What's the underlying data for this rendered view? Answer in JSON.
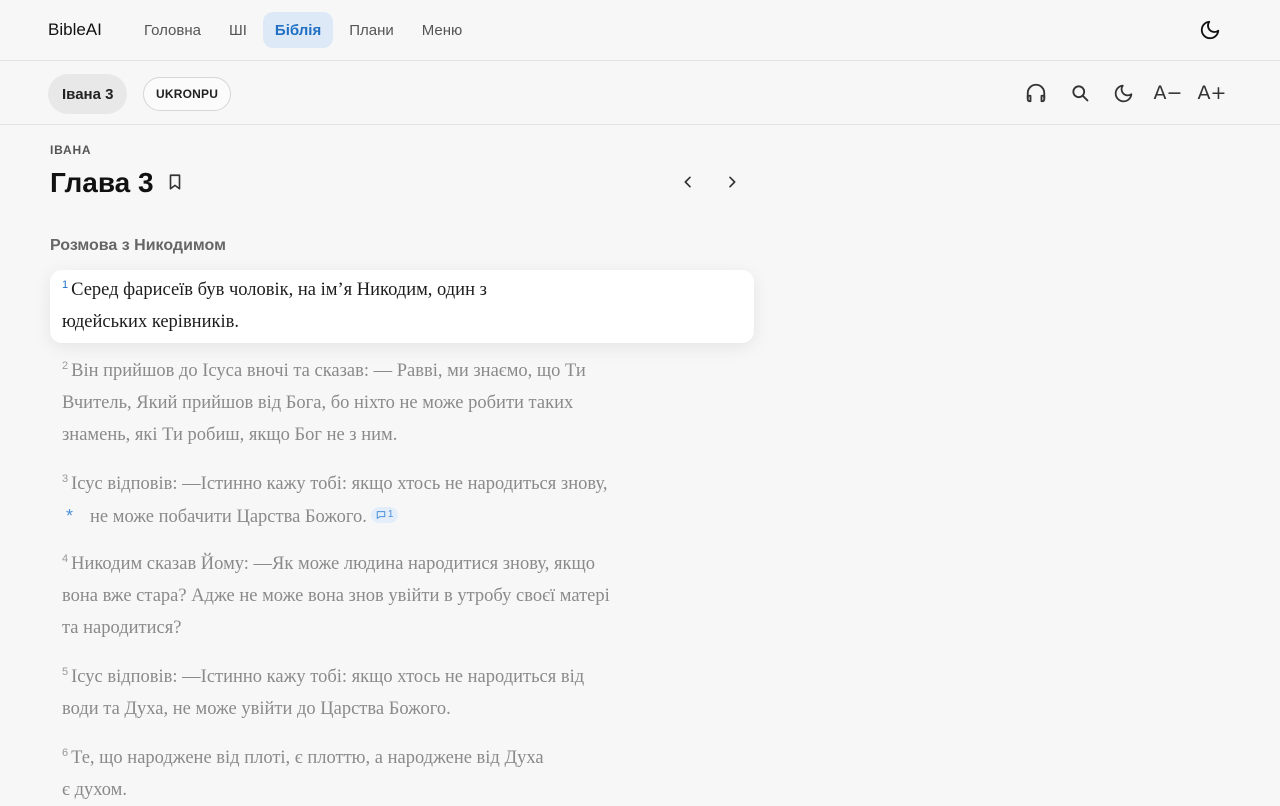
{
  "app": {
    "brand": "BibleAI"
  },
  "nav": {
    "items": [
      {
        "label": "Головна"
      },
      {
        "label": "ШІ"
      },
      {
        "label": "Біблія"
      },
      {
        "label": "Плани"
      },
      {
        "label": "Меню"
      }
    ],
    "active": "Біблія"
  },
  "toolbar": {
    "chapter_chip": "Івана 3",
    "version_chip": "UKRONPU",
    "font_decrease": "A−",
    "font_increase": "A+"
  },
  "reader": {
    "book": "ІВАНА",
    "chapter_title": "Глава 3",
    "section_heading": "Розмова з Никодимом",
    "verses": [
      {
        "num": "1",
        "line1": "Серед фарисеїв був чоловік, на ім’я Никодим, один з",
        "line2": "юдейських керівників."
      },
      {
        "num": "2",
        "line1": "Він прийшов до Ісуса вночі та сказав: — Раввi, ми знаємо, що Ти",
        "line2": "Вчитель, Який прийшов від Бога, бо ніхто не може робити таких",
        "line3": "знамень, які Ти робиш, якщо Бог не з ним."
      },
      {
        "num": "3",
        "line1": "Ісус відповів: —Істинно кажу тобі: якщо хтось не народиться знову,",
        "footnote": "*",
        "line2": "не може побачити Царства Божого.",
        "note_count": "1"
      },
      {
        "num": "4",
        "line1": "Никодим сказав Йому: —Як може людина народитися знову, якщо",
        "line2": "вона вже стара? Адже не може вона знов увійти в утробу своєї матері",
        "line3": "та народитися?"
      },
      {
        "num": "5",
        "line1": "Ісус відповів: —Істинно кажу тобі: якщо хтось не народиться від",
        "line2": "води та Духа, не може увійти до Царства Божого."
      },
      {
        "num": "6",
        "line1": "Те, що народжене від плоті, є плоттю, а народжене від Духа",
        "line2": "є духом."
      }
    ]
  },
  "colors": {
    "accent": "#1f6fc4",
    "accent_bg": "#dde9f6",
    "background": "#f7f7f7",
    "dim_text": "#8a8a8a"
  }
}
